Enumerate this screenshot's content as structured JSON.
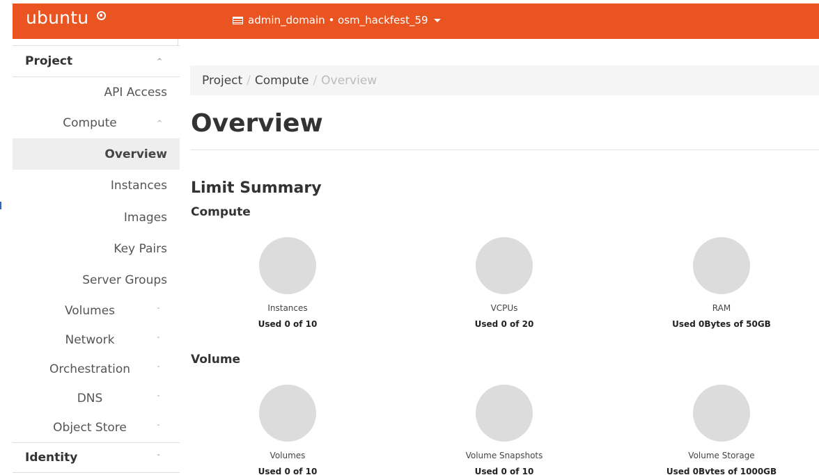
{
  "brand": {
    "name": "ubuntu"
  },
  "header": {
    "project_selector": "admin_domain • osm_hackfest_59"
  },
  "sidebar": {
    "project_label": "Project",
    "api_access": "API Access",
    "compute_label": "Compute",
    "compute_items": [
      "Overview",
      "Instances",
      "Images",
      "Key Pairs",
      "Server Groups"
    ],
    "volumes": "Volumes",
    "network": "Network",
    "orchestration": "Orchestration",
    "dns": "DNS",
    "object_store": "Object Store",
    "identity_label": "Identity"
  },
  "breadcrumb": [
    "Project",
    "Compute",
    "Overview"
  ],
  "page_title": "Overview",
  "limit_summary": {
    "title": "Limit Summary",
    "compute": {
      "label": "Compute",
      "items": [
        {
          "name": "Instances",
          "usage": "Used 0 of 10"
        },
        {
          "name": "VCPUs",
          "usage": "Used 0 of 20"
        },
        {
          "name": "RAM",
          "usage": "Used 0Bytes of 50GB"
        }
      ]
    },
    "volume": {
      "label": "Volume",
      "items": [
        {
          "name": "Volumes",
          "usage": "Used 0 of 10"
        },
        {
          "name": "Volume Snapshots",
          "usage": "Used 0 of 10"
        },
        {
          "name": "Volume Storage",
          "usage": "Used 0Bvtes of 1000GB"
        }
      ]
    }
  },
  "icons": {
    "brand_mark": "circle-of-friends-icon",
    "project_selector": "project-list-icon",
    "selector_caret": "caret-down-icon",
    "expand": "chevron-up-icon",
    "collapse": "chevron-down-icon"
  },
  "colors": {
    "accent": "#e95420",
    "quota_circle": "#dcdcdc",
    "active_bg": "#eeeeee"
  }
}
